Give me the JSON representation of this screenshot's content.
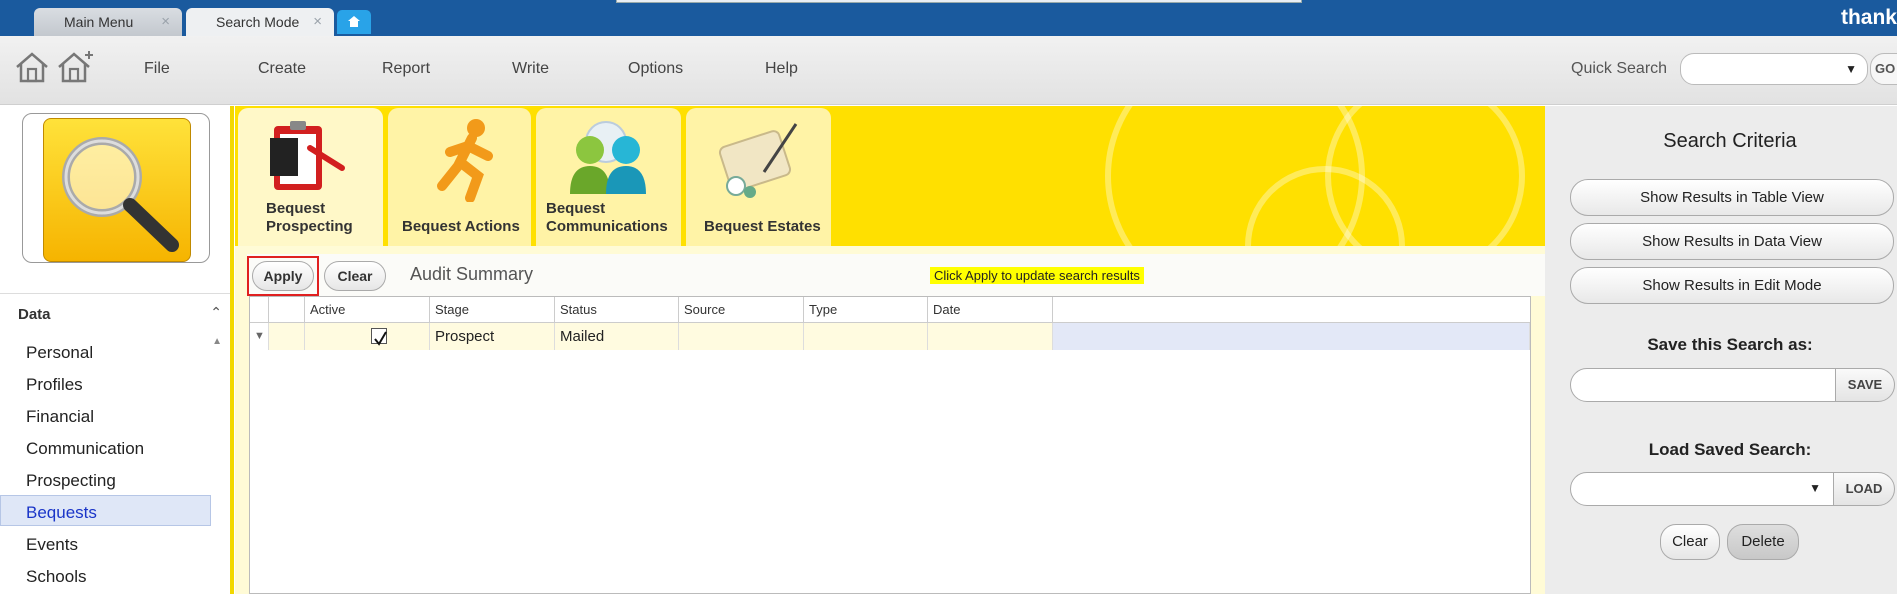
{
  "tabs": {
    "main_menu": "Main Menu",
    "search_mode": "Search Mode",
    "close": "×"
  },
  "brand": "thank",
  "menu": {
    "items": [
      "File",
      "Create",
      "Report",
      "Write",
      "Options",
      "Help"
    ],
    "quick_search_label": "Quick Search",
    "go_label": "GO"
  },
  "sidebar": {
    "section_title": "Data",
    "items": [
      "Personal",
      "Profiles",
      "Financial",
      "Communication",
      "Prospecting",
      "Bequests",
      "Events",
      "Schools"
    ],
    "active_item": "Bequests"
  },
  "banner_tabs": [
    {
      "line1": "Bequest",
      "line2": "Prospecting"
    },
    {
      "line1": "Bequest Actions",
      "line2": ""
    },
    {
      "line1": "Bequest",
      "line2": "Communications"
    },
    {
      "line1": "Bequest Estates",
      "line2": ""
    }
  ],
  "toolbar": {
    "apply_label": "Apply",
    "clear_label": "Clear",
    "title": "Audit Summary",
    "hint": "Click Apply to update search results"
  },
  "grid": {
    "columns": [
      "Active",
      "Stage",
      "Status",
      "Source",
      "Type",
      "Date"
    ],
    "rows": [
      {
        "active": true,
        "stage": "Prospect",
        "status": "Mailed",
        "source": "",
        "type": "",
        "date": ""
      }
    ]
  },
  "right_panel": {
    "title": "Search Criteria",
    "btn_table_view": "Show Results in Table View",
    "btn_data_view": "Show Results in Data View",
    "btn_edit_mode": "Show Results in Edit Mode",
    "save_label": "Save this Search as:",
    "save_button": "SAVE",
    "load_label": "Load Saved Search:",
    "load_button": "LOAD",
    "clear_button": "Clear",
    "delete_button": "Delete"
  },
  "colors": {
    "header_blue": "#1a5a9e",
    "banner_yellow": "#ffe000",
    "active_blue_text": "#1a35c8",
    "highlight_red": "#e02020"
  }
}
